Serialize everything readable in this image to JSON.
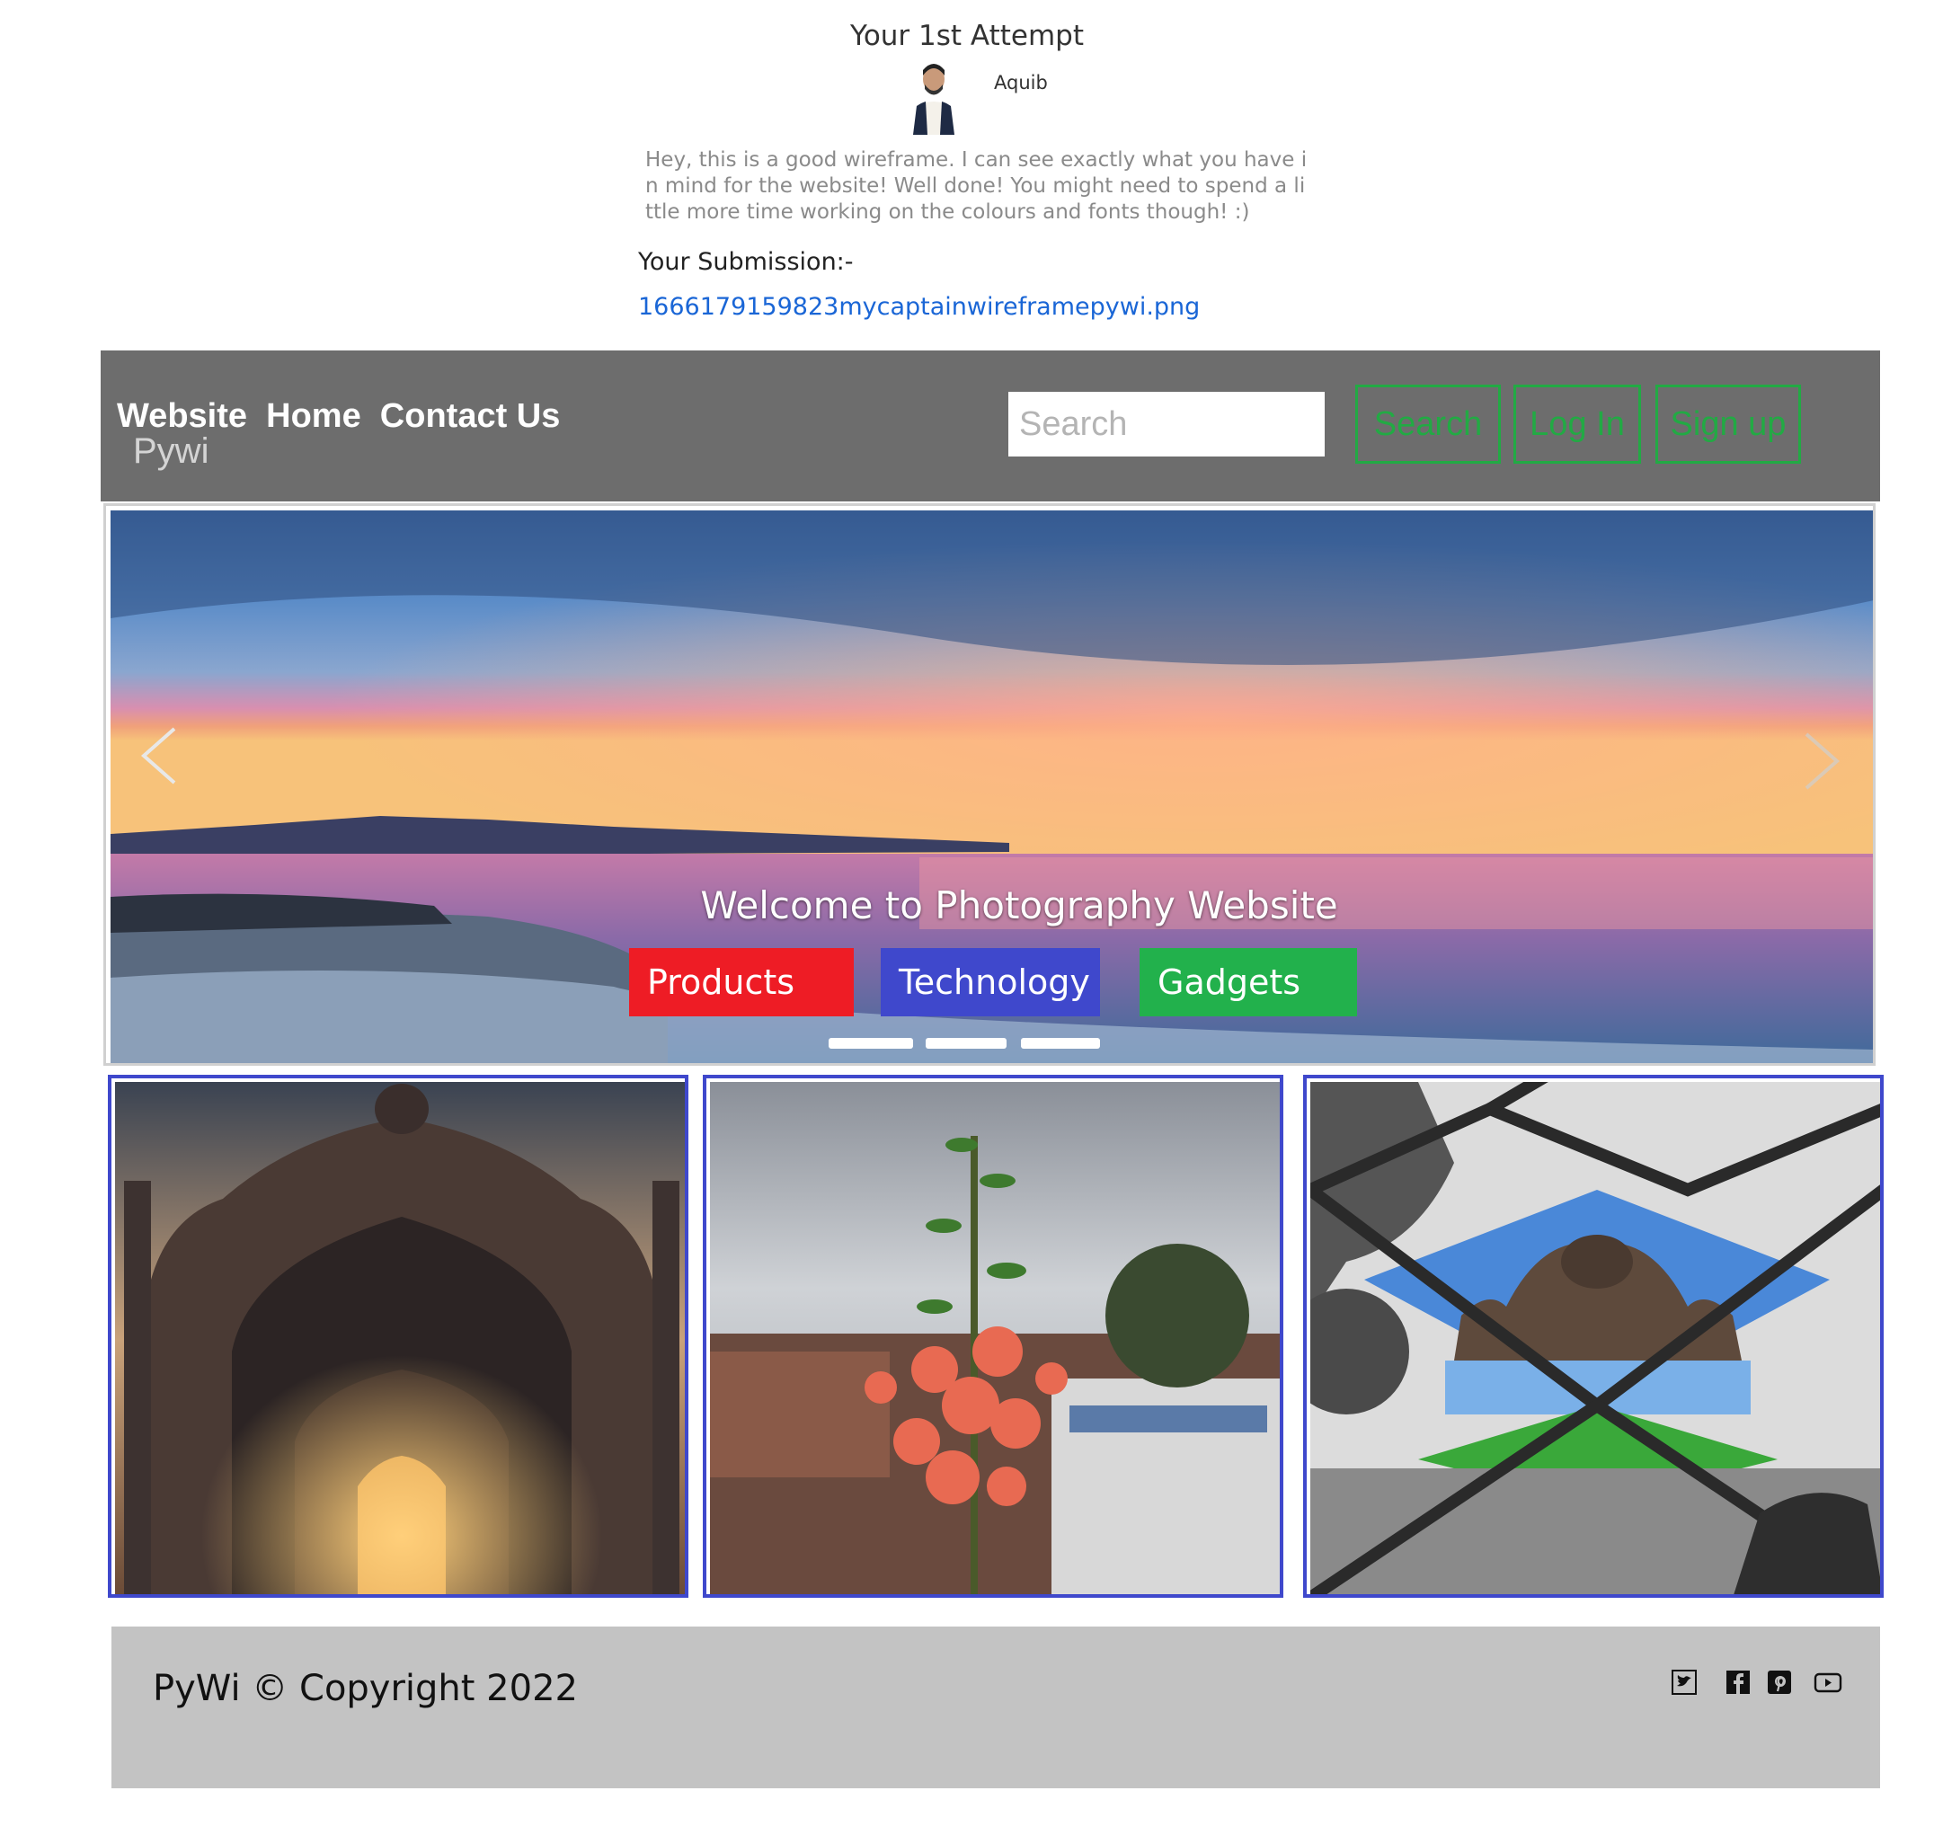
{
  "review": {
    "attempt_title": "Your 1st Attempt",
    "reviewer_name": "Aquib",
    "comment": "Hey, this is a good wireframe. I can see exactly what you have in mind for the website! Well done! You might need to spend a little more time working on the colours and fonts though! :)",
    "submission_label": "Your Submission:-",
    "submission_file": "1666179159823mycaptainwireframepywi.png"
  },
  "wireframe": {
    "nav": {
      "menu": "Website  Home  Contact Us",
      "brand_sub": "Pywi",
      "search_placeholder": "Search",
      "search_button": "Search",
      "login_button": "Log In",
      "signup_button": "Sign up"
    },
    "carousel": {
      "caption": "Welcome to Photography Website",
      "buttons": [
        "Products",
        "Technology",
        "Gadgets"
      ],
      "indicator_count": 3,
      "prev_icon": "chevron-left-icon",
      "next_icon": "chevron-right-icon"
    },
    "gallery": {
      "photos": [
        "gateway-photo",
        "flower-photo",
        "fenced-monument-photo"
      ]
    },
    "footer": {
      "copyright": "PyWi © Copyright 2022",
      "social_icons": [
        "twitter-icon",
        "facebook-icon",
        "pinterest-icon",
        "youtube-icon"
      ]
    }
  },
  "colors": {
    "nav_bg": "#6d6d6d",
    "nav_button_border": "#22aa44",
    "products": "#ee1c25",
    "technology": "#3f48cc",
    "gadgets": "#22b14c",
    "photo_border": "#3f48cc",
    "footer_bg": "#c3c3c3",
    "link": "#1a66d6"
  }
}
